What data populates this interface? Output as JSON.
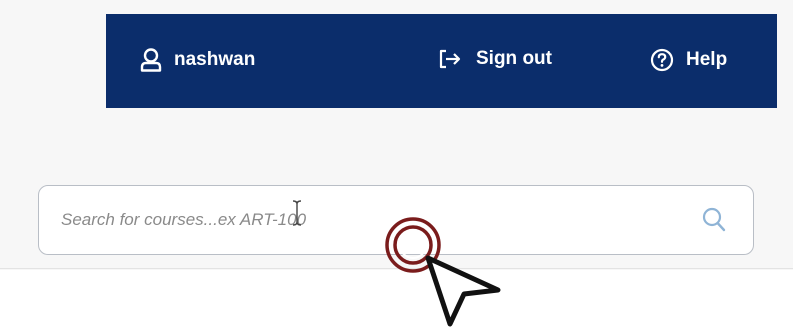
{
  "header": {
    "user": {
      "label": "nashwan",
      "icon": "user-icon"
    },
    "signout": {
      "label": "Sign out",
      "icon": "sign-out-icon"
    },
    "help": {
      "label": "Help",
      "icon": "help-icon"
    },
    "background_color": "#0b2d6b"
  },
  "search": {
    "placeholder": "Search for courses...ex ART-100",
    "value": "",
    "icon": "search-icon"
  },
  "colors": {
    "accent": "#0b2d6b",
    "click_indicator": "#7a1c1c",
    "search_icon": "#8fb4d6"
  }
}
